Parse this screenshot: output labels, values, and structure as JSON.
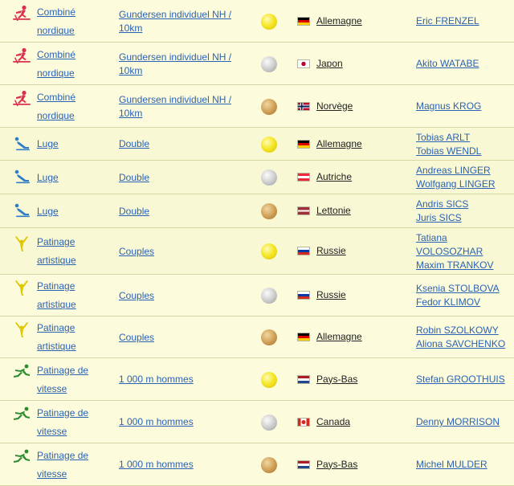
{
  "rows": [
    {
      "sport": "Combiné nordique",
      "sport_icon": "nordic-combined-icon",
      "event": "Gundersen individuel NH / 10km",
      "medal": "gold",
      "flag": "germany-flag",
      "country": "Allemagne",
      "athletes": [
        "Eric FRENZEL"
      ]
    },
    {
      "sport": "Combiné nordique",
      "sport_icon": "nordic-combined-icon",
      "event": "Gundersen individuel NH / 10km",
      "medal": "silver",
      "flag": "japan-flag",
      "country": "Japon",
      "athletes": [
        "Akito WATABE"
      ]
    },
    {
      "sport": "Combiné nordique",
      "sport_icon": "nordic-combined-icon",
      "event": "Gundersen individuel NH / 10km",
      "medal": "bronze",
      "flag": "norway-flag",
      "country": "Norvège",
      "athletes": [
        "Magnus KROG"
      ]
    },
    {
      "sport": "Luge",
      "sport_icon": "luge-icon",
      "event": "Double",
      "medal": "gold",
      "flag": "germany-flag",
      "country": "Allemagne",
      "athletes": [
        "Tobias ARLT",
        "Tobias WENDL"
      ]
    },
    {
      "sport": "Luge",
      "sport_icon": "luge-icon",
      "event": "Double",
      "medal": "silver",
      "flag": "austria-flag",
      "country": "Autriche",
      "athletes": [
        "Andreas LINGER",
        "Wolfgang LINGER"
      ]
    },
    {
      "sport": "Luge",
      "sport_icon": "luge-icon",
      "event": "Double",
      "medal": "bronze",
      "flag": "latvia-flag",
      "country": "Lettonie",
      "athletes": [
        "Andris SICS",
        "Juris SICS"
      ]
    },
    {
      "sport": "Patinage artistique",
      "sport_icon": "figure-skating-icon",
      "event": "Couples",
      "medal": "gold",
      "flag": "russia-flag",
      "country": "Russie",
      "athletes": [
        "Tatiana VOLOSOZHAR",
        "Maxim TRANKOV"
      ]
    },
    {
      "sport": "Patinage artistique",
      "sport_icon": "figure-skating-icon",
      "event": "Couples",
      "medal": "silver",
      "flag": "russia-flag",
      "country": "Russie",
      "athletes": [
        "Ksenia STOLBOVA",
        "Fedor KLIMOV"
      ]
    },
    {
      "sport": "Patinage artistique",
      "sport_icon": "figure-skating-icon",
      "event": "Couples",
      "medal": "bronze",
      "flag": "germany-flag",
      "country": "Allemagne",
      "athletes": [
        "Robin SZOLKOWY",
        "Aliona SAVCHENKO"
      ]
    },
    {
      "sport": "Patinage de vitesse",
      "sport_icon": "speed-skating-icon",
      "event": "1 000 m hommes",
      "medal": "gold",
      "flag": "netherlands-flag",
      "country": "Pays-Bas",
      "athletes": [
        "Stefan GROOTHUIS"
      ]
    },
    {
      "sport": "Patinage de vitesse",
      "sport_icon": "speed-skating-icon",
      "event": "1 000 m hommes",
      "medal": "silver",
      "flag": "canada-flag",
      "country": "Canada",
      "athletes": [
        "Denny MORRISON"
      ]
    },
    {
      "sport": "Patinage de vitesse",
      "sport_icon": "speed-skating-icon",
      "event": "1 000 m hommes",
      "medal": "bronze",
      "flag": "netherlands-flag",
      "country": "Pays-Bas",
      "athletes": [
        "Michel MULDER"
      ]
    }
  ]
}
